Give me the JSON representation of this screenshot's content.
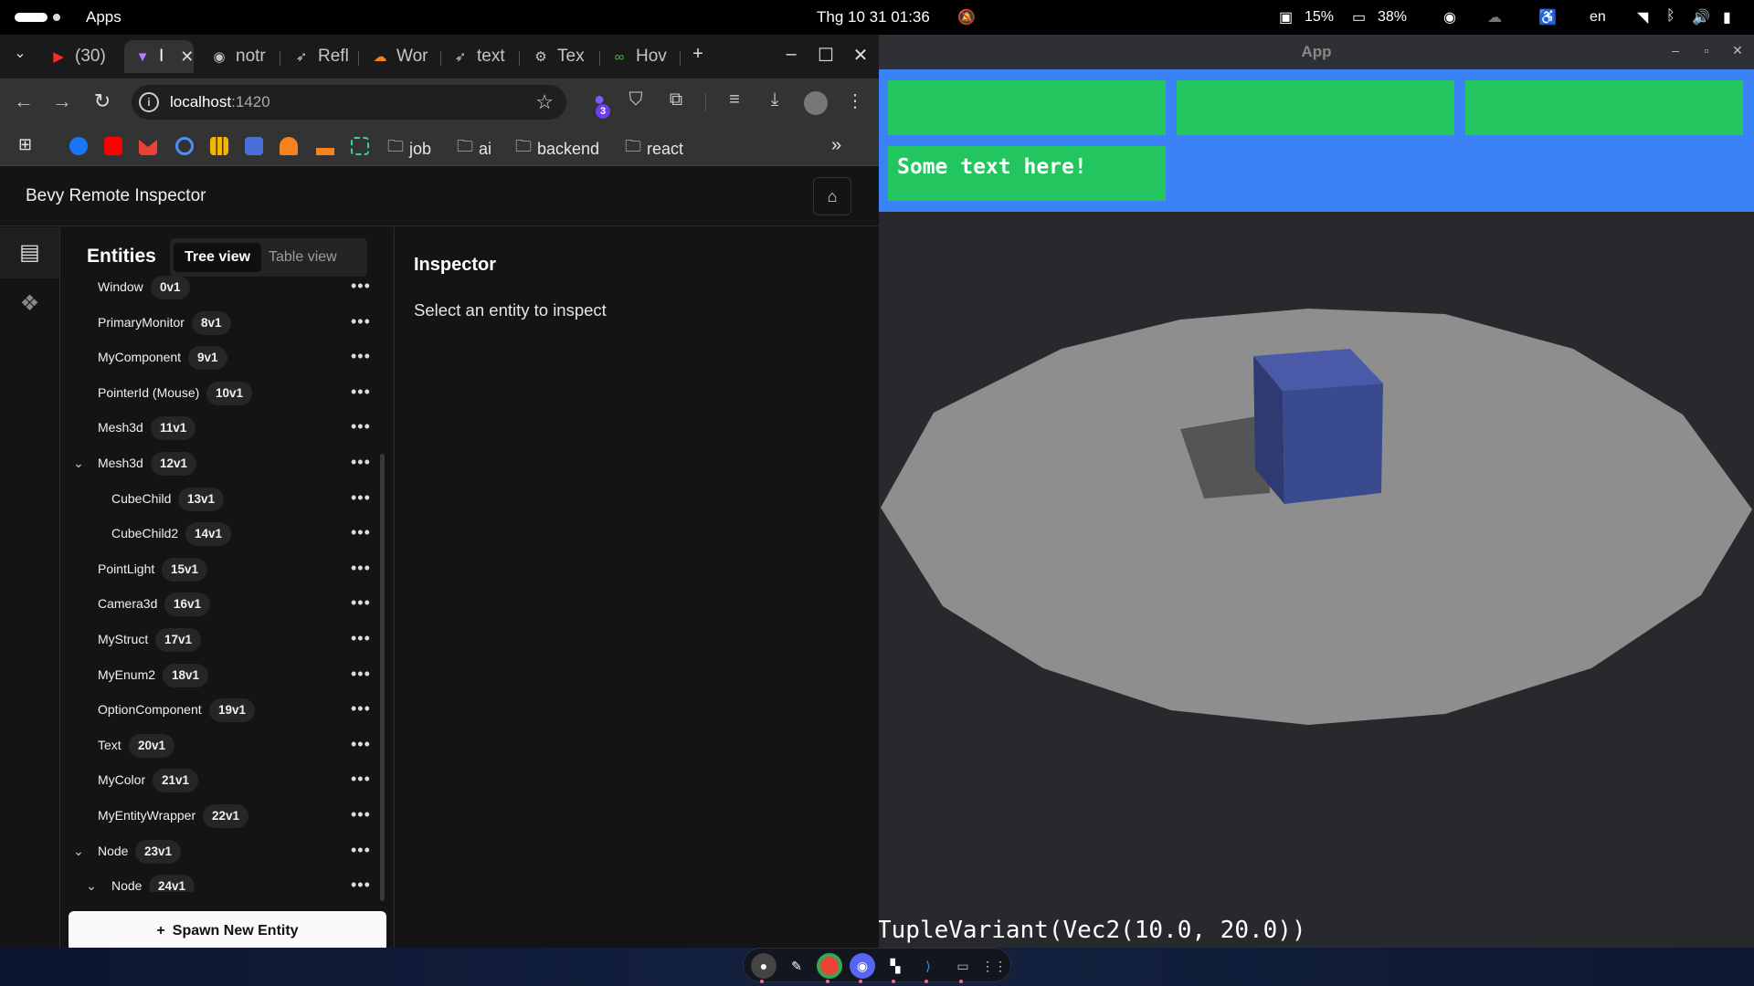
{
  "system_bar": {
    "launcher_label": "Apps",
    "clock": "Thg 10 31  01:36",
    "cpu": "15%",
    "battery_device": "38%",
    "language": "en"
  },
  "browser": {
    "tabs": [
      {
        "label": "(30)",
        "icon": "youtube-icon"
      },
      {
        "label": "I",
        "icon": "vite-icon",
        "active": true
      },
      {
        "label": "notr",
        "icon": "github-icon"
      },
      {
        "label": "Refl",
        "icon": "rust-doc-icon"
      },
      {
        "label": "Wor",
        "icon": "cloudflare-icon"
      },
      {
        "label": "text",
        "icon": "rust-doc-icon"
      },
      {
        "label": "Tex",
        "icon": "rust-crab-icon"
      },
      {
        "label": "Hov",
        "icon": "infinity-icon"
      }
    ],
    "new_tab": "+",
    "url_host": "localhost",
    "url_port": ":1420",
    "extension_badge": "3",
    "bookmarks": [
      {
        "label": "job"
      },
      {
        "label": "ai"
      },
      {
        "label": "backend"
      },
      {
        "label": "react"
      }
    ],
    "bookmarks_overflow": "»"
  },
  "page": {
    "title": "Bevy Remote Inspector",
    "entities_heading": "Entities",
    "view_toggle": {
      "tree": "Tree view",
      "table": "Table view"
    },
    "entities": [
      {
        "name": "Window",
        "id": "0v1",
        "depth": 0,
        "expanded": null
      },
      {
        "name": "PrimaryMonitor",
        "id": "8v1",
        "depth": 0,
        "expanded": null
      },
      {
        "name": "MyComponent",
        "id": "9v1",
        "depth": 0,
        "expanded": null
      },
      {
        "name": "PointerId (Mouse)",
        "id": "10v1",
        "depth": 0,
        "expanded": null
      },
      {
        "name": "Mesh3d",
        "id": "11v1",
        "depth": 0,
        "expanded": null
      },
      {
        "name": "Mesh3d",
        "id": "12v1",
        "depth": 0,
        "expanded": true
      },
      {
        "name": "CubeChild",
        "id": "13v1",
        "depth": 1,
        "expanded": null
      },
      {
        "name": "CubeChild2",
        "id": "14v1",
        "depth": 1,
        "expanded": null
      },
      {
        "name": "PointLight",
        "id": "15v1",
        "depth": 0,
        "expanded": null
      },
      {
        "name": "Camera3d",
        "id": "16v1",
        "depth": 0,
        "expanded": null
      },
      {
        "name": "MyStruct",
        "id": "17v1",
        "depth": 0,
        "expanded": null
      },
      {
        "name": "MyEnum2",
        "id": "18v1",
        "depth": 0,
        "expanded": null
      },
      {
        "name": "OptionComponent",
        "id": "19v1",
        "depth": 0,
        "expanded": null
      },
      {
        "name": "Text",
        "id": "20v1",
        "depth": 0,
        "expanded": null
      },
      {
        "name": "MyColor",
        "id": "21v1",
        "depth": 0,
        "expanded": null
      },
      {
        "name": "MyEntityWrapper",
        "id": "22v1",
        "depth": 0,
        "expanded": null
      },
      {
        "name": "Node",
        "id": "23v1",
        "depth": 0,
        "expanded": true
      },
      {
        "name": "Node",
        "id": "24v1",
        "depth": 1,
        "expanded": true
      }
    ],
    "spawn_button": "Spawn New Entity",
    "inspector_heading": "Inspector",
    "inspector_placeholder": "Select an entity to inspect"
  },
  "app_window": {
    "title": "App",
    "ui_text": "Some text here!",
    "bottom_text": "TupleVariant(Vec2(10.0, 20.0))",
    "colors": {
      "ui_background": "#3b82f6",
      "ui_box": "#22c55e",
      "cube": "#3a4a8f",
      "ground": "#8e8e8e"
    }
  }
}
